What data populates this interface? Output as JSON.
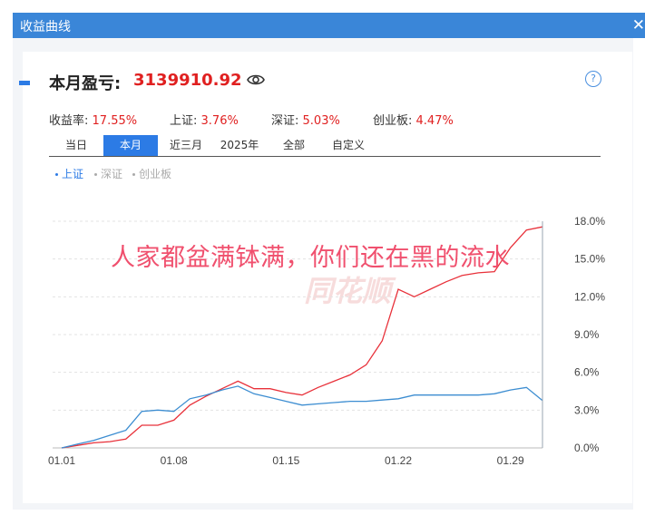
{
  "window": {
    "title": "收益曲线",
    "close_glyph": "✕"
  },
  "summary": {
    "pl_label": "本月盈亏:",
    "pl_value": "3139910.92",
    "help_glyph": "?"
  },
  "stats": [
    {
      "label": "收益率:",
      "value": "17.55%"
    },
    {
      "label": "上证:",
      "value": "3.76%"
    },
    {
      "label": "深证:",
      "value": "5.03%"
    },
    {
      "label": "创业板:",
      "value": "4.47%"
    }
  ],
  "tabs": [
    "当日",
    "本月",
    "近三月",
    "2025年",
    "全部",
    "自定义"
  ],
  "active_tab": "本月",
  "legend": [
    {
      "label": "上证",
      "active": true
    },
    {
      "label": "深证",
      "active": false
    },
    {
      "label": "创业板",
      "active": false
    }
  ],
  "watermark_text": "人家都盆满钵满，你们还在黑的流水",
  "brand_watermark": "同花顺",
  "colors": {
    "accent": "#2c7be5",
    "titlebar": "#3a86d8",
    "profit": "#e02020",
    "series_return": "#e8313a",
    "series_index": "#3c8dd1",
    "inactive_legend": "#aaaaaa"
  },
  "chart_data": {
    "type": "line",
    "x_ticks": [
      "01.01",
      "01.08",
      "01.15",
      "01.22",
      "01.29"
    ],
    "y_ticks": [
      "0.0%",
      "3.0%",
      "6.0%",
      "9.0%",
      "12.0%",
      "15.0%",
      "18.0%"
    ],
    "ylim": [
      0,
      18
    ],
    "xlim": [
      1,
      31
    ],
    "grid": true,
    "series": [
      {
        "color": "#e8313a",
        "points": [
          [
            1,
            0
          ],
          [
            2,
            0.2
          ],
          [
            3,
            0.4
          ],
          [
            4,
            0.5
          ],
          [
            5,
            0.7
          ],
          [
            6,
            1.8
          ],
          [
            7,
            1.8
          ],
          [
            8,
            2.2
          ],
          [
            9,
            3.4
          ],
          [
            10,
            4.1
          ],
          [
            11,
            4.7
          ],
          [
            12,
            5.3
          ],
          [
            13,
            4.7
          ],
          [
            14,
            4.7
          ],
          [
            15,
            4.4
          ],
          [
            16,
            4.2
          ],
          [
            17,
            4.8
          ],
          [
            18,
            5.3
          ],
          [
            19,
            5.8
          ],
          [
            20,
            6.6
          ],
          [
            21,
            8.5
          ],
          [
            22,
            12.6
          ],
          [
            23,
            12.0
          ],
          [
            24,
            12.6
          ],
          [
            25,
            13.2
          ],
          [
            26,
            13.7
          ],
          [
            27,
            13.9
          ],
          [
            28,
            14.0
          ],
          [
            29,
            15.9
          ],
          [
            30,
            17.3
          ],
          [
            31,
            17.55
          ]
        ]
      },
      {
        "color": "#3c8dd1",
        "points": [
          [
            1,
            0
          ],
          [
            2,
            0.3
          ],
          [
            3,
            0.6
          ],
          [
            4,
            1.0
          ],
          [
            5,
            1.4
          ],
          [
            6,
            2.9
          ],
          [
            7,
            3.0
          ],
          [
            8,
            2.9
          ],
          [
            9,
            3.9
          ],
          [
            10,
            4.2
          ],
          [
            11,
            4.6
          ],
          [
            12,
            4.9
          ],
          [
            13,
            4.3
          ],
          [
            14,
            4.0
          ],
          [
            15,
            3.7
          ],
          [
            16,
            3.4
          ],
          [
            17,
            3.5
          ],
          [
            18,
            3.6
          ],
          [
            19,
            3.7
          ],
          [
            20,
            3.7
          ],
          [
            21,
            3.8
          ],
          [
            22,
            3.9
          ],
          [
            23,
            4.2
          ],
          [
            24,
            4.2
          ],
          [
            25,
            4.2
          ],
          [
            26,
            4.2
          ],
          [
            27,
            4.2
          ],
          [
            28,
            4.3
          ],
          [
            29,
            4.6
          ],
          [
            30,
            4.8
          ],
          [
            31,
            3.76
          ]
        ]
      }
    ]
  }
}
